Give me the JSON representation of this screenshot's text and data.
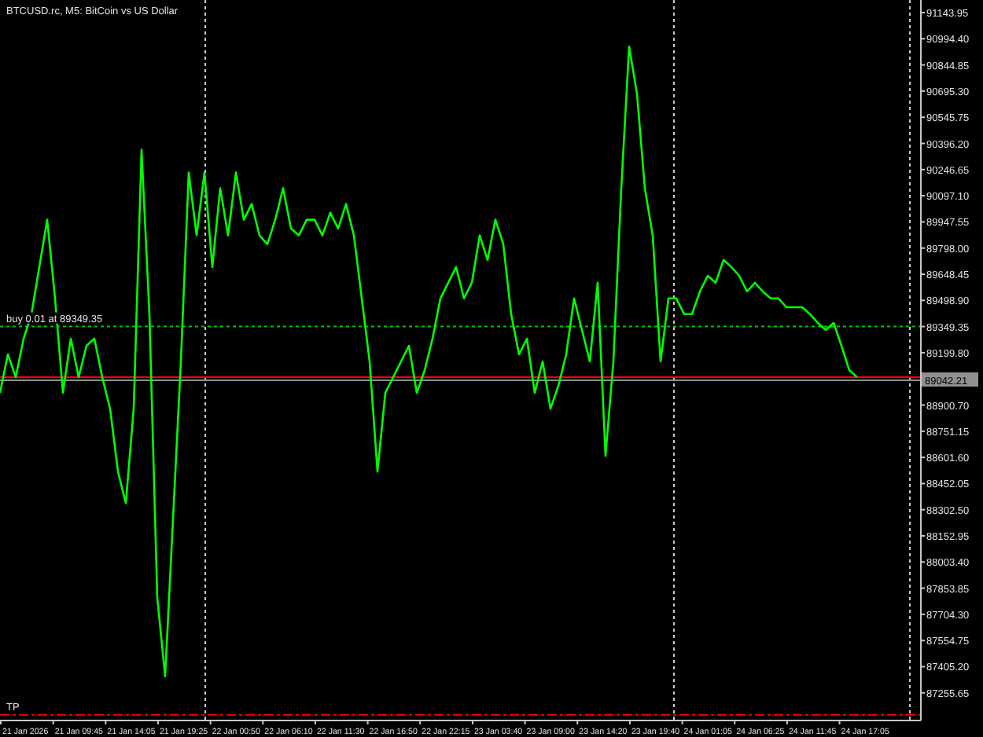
{
  "order_label": "buy 0.01 at 89349.35",
  "current_price": "89042.21",
  "tp_label": "TP",
  "time_labels": [
    "21 Jan 2026",
    "21 Jan 09:45",
    "21 Jan 14:05",
    "21 Jan 19:25",
    "22 Jan 00:50",
    "22 Jan 06:10",
    "22 Jan 11:30",
    "22 Jan 16:50",
    "22 Jan 22:15",
    "23 Jan 03:40",
    "23 Jan 09:00",
    "23 Jan 14:20",
    "23 Jan 19:40",
    "24 Jan 01:05",
    "24 Jan 06:25",
    "24 Jan 11:45",
    "24 Jan 17:05"
  ],
  "chart_data": {
    "type": "line",
    "title": "BTCUSD.rc, M5:  BitCoin vs US Dollar",
    "ylim": [
      87102,
      91216
    ],
    "yticks": [
      {
        "value": 91143.95,
        "label": "91143.95"
      },
      {
        "value": 90994.4,
        "label": "90994.40"
      },
      {
        "value": 90844.85,
        "label": "90844.85"
      },
      {
        "value": 90695.3,
        "label": "90695.30"
      },
      {
        "value": 90545.75,
        "label": "90545.75"
      },
      {
        "value": 90396.2,
        "label": "90396.20"
      },
      {
        "value": 90246.65,
        "label": "90246.65"
      },
      {
        "value": 90097.1,
        "label": "90097.10"
      },
      {
        "value": 89947.55,
        "label": "89947.55"
      },
      {
        "value": 89798,
        "label": "89798.00"
      },
      {
        "value": 89648.45,
        "label": "89648.45"
      },
      {
        "value": 89498.9,
        "label": "89498.90"
      },
      {
        "value": 89349.35,
        "label": "89349.35"
      },
      {
        "value": 89199.8,
        "label": "89199.80"
      },
      {
        "value": 88900.7,
        "label": "88900.70"
      },
      {
        "value": 88751.15,
        "label": "88751.15"
      },
      {
        "value": 88601.6,
        "label": "88601.60"
      },
      {
        "value": 88452.05,
        "label": "88452.05"
      },
      {
        "value": 88302.5,
        "label": "88302.50"
      },
      {
        "value": 88152.95,
        "label": "88152.95"
      },
      {
        "value": 88003.4,
        "label": "88003.40"
      },
      {
        "value": 87853.85,
        "label": "87853.85"
      },
      {
        "value": 87704.3,
        "label": "87704.30"
      },
      {
        "value": 87554.75,
        "label": "87554.75"
      },
      {
        "value": 87405.2,
        "label": "87405.20"
      },
      {
        "value": 87255.65,
        "label": "87255.65"
      }
    ],
    "series": [
      {
        "color": "#00ff00",
        "values": [
          88970,
          89190,
          89060,
          89280,
          89420,
          89690,
          89960,
          89510,
          88970,
          89280,
          89060,
          89240,
          89280,
          89060,
          88880,
          88520,
          88340,
          88880,
          90360,
          89420,
          87800,
          87350,
          88250,
          89150,
          90230,
          89870,
          90230,
          89690,
          90140,
          89870,
          90230,
          89960,
          90050,
          89870,
          89820,
          89960,
          90140,
          89910,
          89870,
          89960,
          89960,
          89870,
          90000,
          89910,
          90050,
          89870,
          89510,
          89150,
          88520,
          88970,
          89060,
          89150,
          89240,
          88970,
          89100,
          89280,
          89510,
          89600,
          89690,
          89510,
          89600,
          89870,
          89730,
          89960,
          89820,
          89420,
          89190,
          89280,
          88970,
          89150,
          88880,
          89010,
          89190,
          89510,
          89330,
          89150,
          89600,
          88610,
          89150,
          90140,
          90950,
          90680,
          90140,
          89870,
          89150,
          89510,
          89510,
          89420,
          89420,
          89550,
          89640,
          89600,
          89730,
          89690,
          89640,
          89550,
          89600,
          89550,
          89510,
          89510,
          89460,
          89460,
          89460,
          89420,
          89370,
          89330,
          89370,
          89240,
          89100,
          89060
        ]
      }
    ],
    "ref_lines": [
      {
        "axis": "y",
        "value": 89349.35,
        "color": "#00c800"
      },
      {
        "axis": "y",
        "value": 89060,
        "color": "#ff0000"
      },
      {
        "axis": "y",
        "value": 89042.21,
        "color": "#909090"
      },
      {
        "axis": "y",
        "value": 87130,
        "color": "#ff0000"
      }
    ]
  }
}
